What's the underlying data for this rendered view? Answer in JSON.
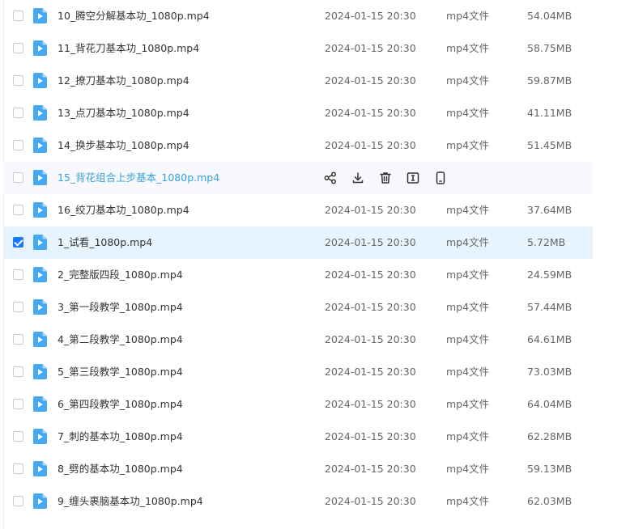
{
  "colors": {
    "accent": "#1677ff",
    "icon_blue": "#45a8f3",
    "hover_name": "#3aa0dc",
    "selected_row": "#e8f4fd",
    "hover_row": "#f7f9fc"
  },
  "row_actions": [
    {
      "name": "share-icon"
    },
    {
      "name": "download-icon"
    },
    {
      "name": "delete-icon"
    },
    {
      "name": "rename-icon"
    },
    {
      "name": "mobile-icon"
    }
  ],
  "files": [
    {
      "name": "10_腾空分解基本功_1080p.mp4",
      "date": "2024-01-15 20:30",
      "type": "mp4文件",
      "size": "54.04MB",
      "checked": false,
      "state": ""
    },
    {
      "name": "11_背花刀基本功_1080p.mp4",
      "date": "2024-01-15 20:30",
      "type": "mp4文件",
      "size": "58.75MB",
      "checked": false,
      "state": ""
    },
    {
      "name": "12_撩刀基本功_1080p.mp4",
      "date": "2024-01-15 20:30",
      "type": "mp4文件",
      "size": "59.87MB",
      "checked": false,
      "state": ""
    },
    {
      "name": "13_点刀基本功_1080p.mp4",
      "date": "2024-01-15 20:30",
      "type": "mp4文件",
      "size": "41.11MB",
      "checked": false,
      "state": ""
    },
    {
      "name": "14_换步基本功_1080p.mp4",
      "date": "2024-01-15 20:30",
      "type": "mp4文件",
      "size": "51.45MB",
      "checked": false,
      "state": ""
    },
    {
      "name": "15_背花组合上步基本_1080p.mp4",
      "date": "",
      "type": "",
      "size": "",
      "checked": false,
      "state": "hover"
    },
    {
      "name": "16_绞刀基本功_1080p.mp4",
      "date": "2024-01-15 20:30",
      "type": "mp4文件",
      "size": "37.64MB",
      "checked": false,
      "state": ""
    },
    {
      "name": "1_试看_1080p.mp4",
      "date": "2024-01-15 20:30",
      "type": "mp4文件",
      "size": "5.72MB",
      "checked": true,
      "state": "selected"
    },
    {
      "name": "2_完整版四段_1080p.mp4",
      "date": "2024-01-15 20:30",
      "type": "mp4文件",
      "size": "24.59MB",
      "checked": false,
      "state": ""
    },
    {
      "name": "3_第一段教学_1080p.mp4",
      "date": "2024-01-15 20:30",
      "type": "mp4文件",
      "size": "57.44MB",
      "checked": false,
      "state": ""
    },
    {
      "name": "4_第二段教学_1080p.mp4",
      "date": "2024-01-15 20:30",
      "type": "mp4文件",
      "size": "64.61MB",
      "checked": false,
      "state": ""
    },
    {
      "name": "5_第三段教学_1080p.mp4",
      "date": "2024-01-15 20:30",
      "type": "mp4文件",
      "size": "73.03MB",
      "checked": false,
      "state": ""
    },
    {
      "name": "6_第四段教学_1080p.mp4",
      "date": "2024-01-15 20:30",
      "type": "mp4文件",
      "size": "64.04MB",
      "checked": false,
      "state": ""
    },
    {
      "name": "7_刺的基本功_1080p.mp4",
      "date": "2024-01-15 20:30",
      "type": "mp4文件",
      "size": "62.28MB",
      "checked": false,
      "state": ""
    },
    {
      "name": "8_劈的基本功_1080p.mp4",
      "date": "2024-01-15 20:30",
      "type": "mp4文件",
      "size": "59.13MB",
      "checked": false,
      "state": ""
    },
    {
      "name": "9_缠头裹脑基本功_1080p.mp4",
      "date": "2024-01-15 20:30",
      "type": "mp4文件",
      "size": "62.03MB",
      "checked": false,
      "state": ""
    }
  ]
}
